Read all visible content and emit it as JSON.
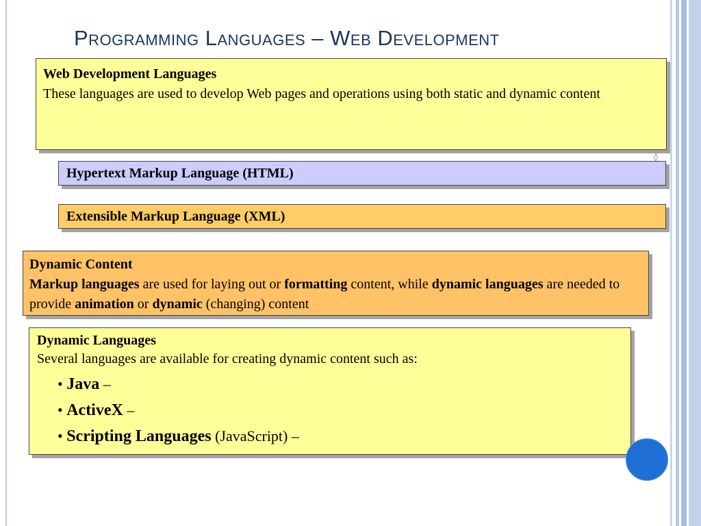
{
  "slide": {
    "title": "Programming Languages – Web Development",
    "boxes": {
      "web_dev": {
        "heading": "Web Development Languages",
        "body": "These languages are used to develop Web pages and operations using both static and dynamic content"
      },
      "html": {
        "label": "Hypertext Markup Language  (HTML)"
      },
      "xml": {
        "label": "Extensible Markup Language  (XML)"
      },
      "dynamic_content": {
        "heading": "Dynamic Content",
        "parts": [
          "Markup languages",
          " are used for laying out or ",
          "formatting",
          " content, while ",
          "dynamic languages",
          " are needed to provide ",
          "animation",
          " or ",
          "dynamic",
          " (changing) content"
        ]
      },
      "dynamic_languages": {
        "heading": "Dynamic Languages",
        "body": "Several languages are available for creating dynamic content such as:",
        "bullets": [
          {
            "term": "Java",
            "rest": " –"
          },
          {
            "term": "ActiveX",
            "rest": " –"
          },
          {
            "term": "Scripting Languages",
            "rest": " (JavaScript) –"
          }
        ]
      }
    },
    "colors": {
      "title": "#17365d",
      "yellow_box": "#ffff99",
      "lilac_box": "#ccccff",
      "orange_box": "#ffcc66",
      "circle": "#1f6fd6"
    },
    "icons": {
      "bullet": "•",
      "corner_mark": "◊"
    }
  }
}
